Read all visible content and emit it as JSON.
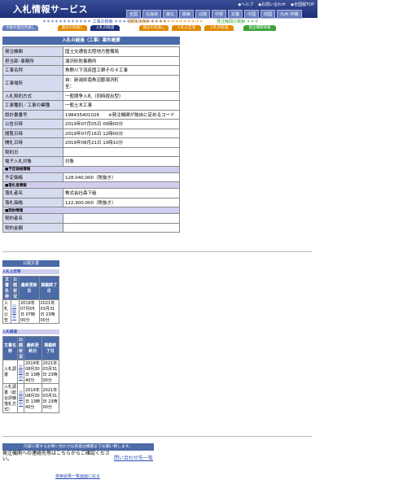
{
  "header": {
    "logo": "入札情報サービス",
    "top_links": [
      "◆ヘルプ",
      "◆お問い合わせ",
      "◆全国版TOP"
    ],
    "regions": [
      "全国",
      "北海道",
      "東北",
      "関東",
      "北陸",
      "中部",
      "近畿",
      "中国",
      "四国",
      "九州･沖縄"
    ]
  },
  "subnav": {
    "s1": "＊＊＊＊＊＊＊＊＊＊＊＊ 工事の検索 ＊＊＊＊＊＊＊＊＊＊＊＊＊",
    "s2": "業務の検索 ＊＊＊＊＊＊＊＊＊＊＊＊＊",
    "s3": "発注機関の検索 ＊＊＊"
  },
  "tabs": [
    {
      "label": "今後の発注見通し",
      "color": "#6a7fc0"
    },
    {
      "label": "発注の見通し",
      "color": "#e08a00"
    },
    {
      "label": "入札の経過",
      "color": "#1e2f78"
    },
    {
      "label": "発注の見通し",
      "color": "#e08a00"
    },
    {
      "label": "入札公告等",
      "color": "#e08a00"
    },
    {
      "label": "入札の経過",
      "color": "#e08a00"
    },
    {
      "label": "発注機関情報",
      "color": "#3aa33a"
    }
  ],
  "main": {
    "title": "入札の経過（工事）案件概要",
    "rows": [
      {
        "k": "発注機関",
        "v": "国土交通省北陸地方整備局"
      },
      {
        "k": "担当部･事務所",
        "v": "湯沢砂防事務所"
      },
      {
        "k": "工事名称",
        "v": "魚野川下流床固工群その４工事"
      },
      {
        "k": "工事場所",
        "v": "自：新潟県南魚沼郡湯沢町\n至："
      },
      {
        "k": "入札契約方式",
        "v": "一般競争入札（同時提出型）"
      },
      {
        "k": "工事種別／工事の業種",
        "v": "一般土木工事"
      },
      {
        "k": "設計書番号",
        "v": "198435401026　　※発注機関が独自に定めるコード"
      },
      {
        "k": "公告日時",
        "v": "2019年07月05日 00時00分"
      },
      {
        "k": "閲覧日時",
        "v": "2019年07月16日 12時00分"
      },
      {
        "k": "開札日時",
        "v": "2019年08月21日 10時10分"
      },
      {
        "k": "契約日",
        "v": ""
      },
      {
        "k": "電子入札対象",
        "v": "対象"
      }
    ],
    "sec_price": "■予定価格情報",
    "price": {
      "k": "予定価格",
      "v": "128,040,000（税抜き）"
    },
    "sec_award": "■落札者情報",
    "award": [
      {
        "k": "落札者名",
        "v": "株式会社森下組"
      },
      {
        "k": "落札価格",
        "v": "122,900,000（税抜き）"
      }
    ],
    "sec_contract": "■契約情報",
    "contract": [
      {
        "k": "契約者名",
        "v": ""
      },
      {
        "k": "契約金額",
        "v": ""
      }
    ]
  },
  "notices": {
    "title": "公開文書",
    "group1_label": "入札公告等",
    "group1_headers": [
      "文書名称",
      "公開状況",
      "最終更新日",
      "掲載終了日"
    ],
    "group1_rows": [
      {
        "name": "入札公告",
        "status": "公開中",
        "updated": "2019年07月05日 07時00分",
        "end": "2021年03月31日 23時00分"
      }
    ],
    "group2_label": "入札経過",
    "group2_headers": [
      "文書名称",
      "公開状況",
      "最終更新日",
      "掲載終了日"
    ],
    "group2_rows": [
      {
        "name": "入札調書",
        "status": "公開中",
        "updated": "2019年08月30日 13時40分",
        "end": "2021年03月31日 23時00分"
      },
      {
        "name": "入札調書（総合評価落札方式）",
        "status": "公開中",
        "updated": "2019年08月30日 13時40分",
        "end": "2021年03月31日 23時00分"
      }
    ]
  },
  "contact": {
    "bar": "内容に関するお問い合わせは各発注機関までお願い致します。",
    "text": "発注機関への連絡先等はこちらからご確認ください。",
    "link": "問い合わせ先一覧"
  },
  "footer": {
    "back": "検索結果一覧画面に戻る"
  }
}
